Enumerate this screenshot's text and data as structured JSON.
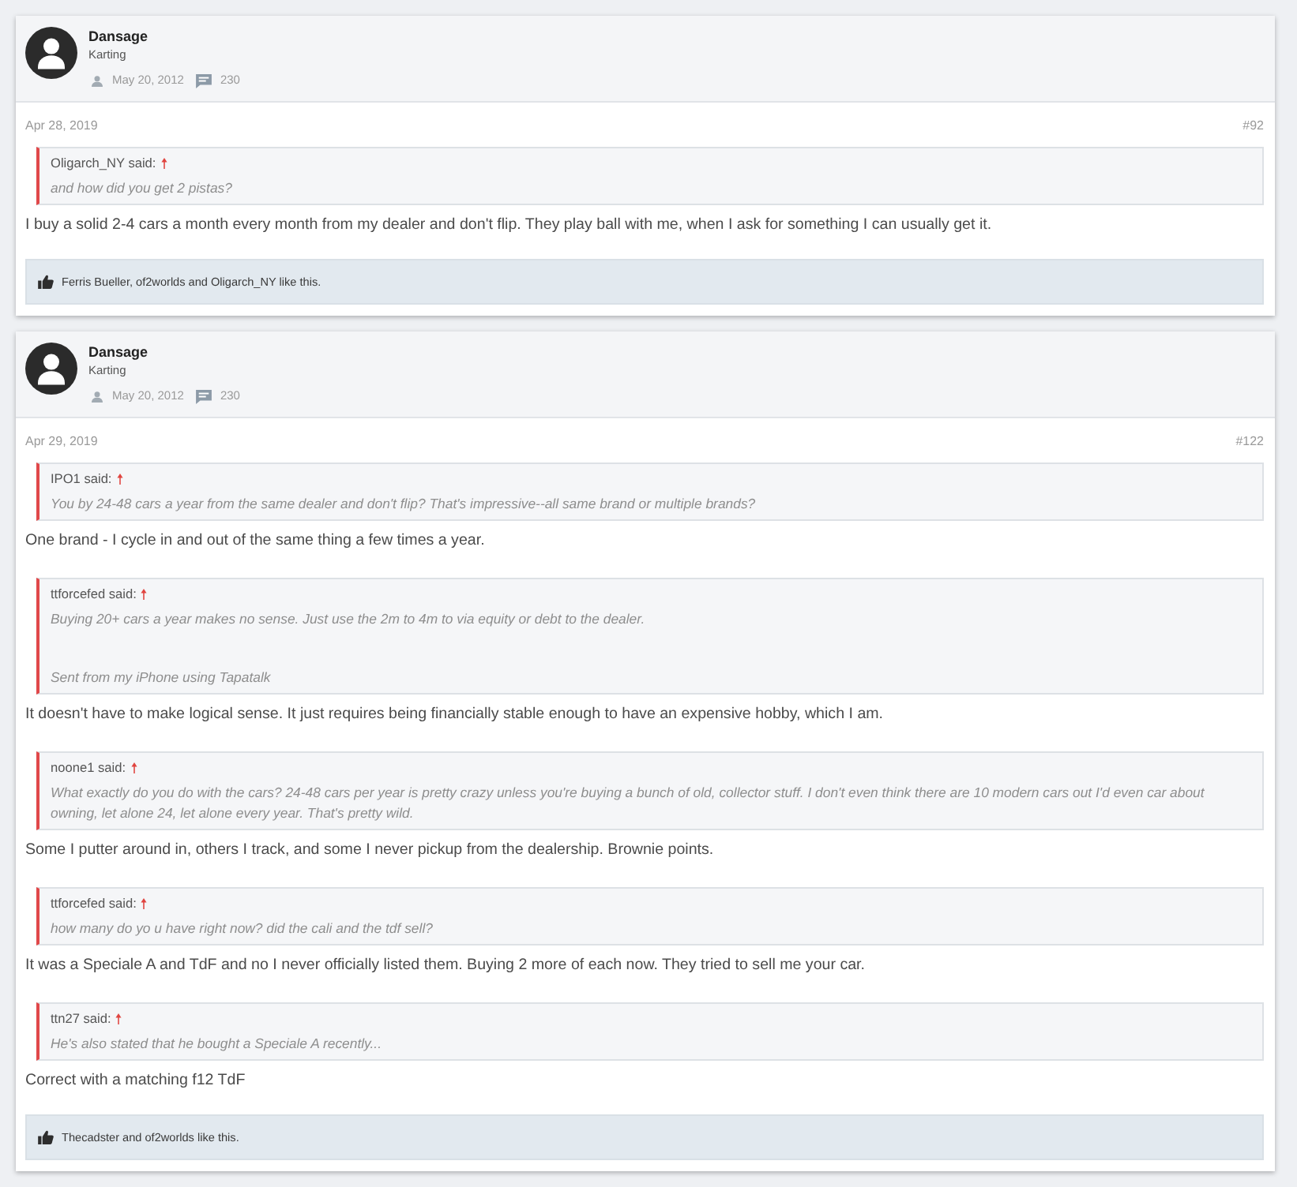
{
  "posts": [
    {
      "author": {
        "name": "Dansage",
        "title": "Karting",
        "joined": "May 20, 2012",
        "messages": "230"
      },
      "date": "Apr 28, 2019",
      "number": "#92",
      "content": [
        {
          "kind": "quote",
          "attribution": "Oligarch_NY said:",
          "paragraphs": [
            "and how did you get 2 pistas?"
          ]
        },
        {
          "kind": "text",
          "text": "I buy a solid 2-4 cars a month every month from my dealer and don't flip. They play ball with me, when I ask for something I can usually get it."
        }
      ],
      "likes": "Ferris Bueller, of2worlds and Oligarch_NY like this."
    },
    {
      "author": {
        "name": "Dansage",
        "title": "Karting",
        "joined": "May 20, 2012",
        "messages": "230"
      },
      "date": "Apr 29, 2019",
      "number": "#122",
      "content": [
        {
          "kind": "quote",
          "attribution": "IPO1 said:",
          "paragraphs": [
            "You by 24-48 cars a year from the same dealer and don't flip? That's impressive--all same brand or multiple brands?"
          ]
        },
        {
          "kind": "text",
          "text": "One brand - I cycle in and out of the same thing a few times a year."
        },
        {
          "kind": "quote",
          "attribution": "ttforcefed said:",
          "paragraphs": [
            "Buying 20+ cars a year makes no sense. Just use the 2m to 4m to via equity or debt to the dealer.",
            "Sent from my iPhone using Tapatalk"
          ]
        },
        {
          "kind": "text",
          "text": "It doesn't have to make logical sense. It just requires being financially stable enough to have an expensive hobby, which I am."
        },
        {
          "kind": "quote",
          "attribution": "noone1 said:",
          "paragraphs": [
            "What exactly do you do with the cars? 24-48 cars per year is pretty crazy unless you're buying a bunch of old, collector stuff. I don't even think there are 10 modern cars out I'd even car about owning, let alone 24, let alone every year. That's pretty wild."
          ]
        },
        {
          "kind": "text",
          "text": "Some I putter around in, others I track, and some I never pickup from the dealership. Brownie points."
        },
        {
          "kind": "quote",
          "attribution": "ttforcefed said:",
          "paragraphs": [
            "how many do yo u have right now? did the cali and the tdf sell?"
          ]
        },
        {
          "kind": "text",
          "text": "It was a Speciale A and TdF and no I never officially listed them. Buying 2 more of each now. They tried to sell me your car."
        },
        {
          "kind": "quote",
          "attribution": "ttn27 said:",
          "paragraphs": [
            "He's also stated that he bought a Speciale A recently..."
          ]
        },
        {
          "kind": "text",
          "text": "Correct with a matching f12 TdF"
        }
      ],
      "likes": "Thecadster and of2worlds like this."
    }
  ]
}
